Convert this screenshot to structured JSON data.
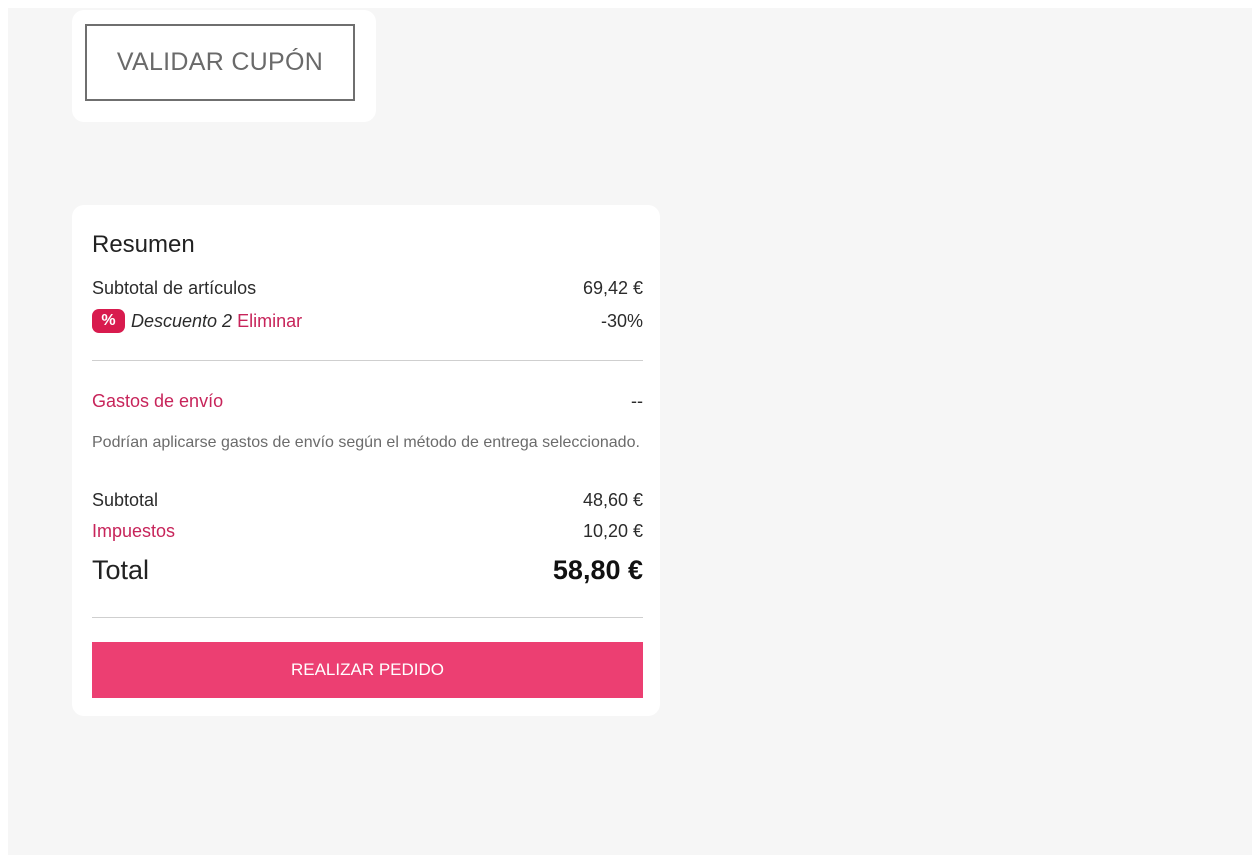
{
  "coupon": {
    "validate_label": "VALIDAR CUPÓN"
  },
  "summary": {
    "title": "Resumen",
    "items_subtotal_label": "Subtotal de artículos",
    "items_subtotal_value": "69,42 €",
    "discount": {
      "badge": "%",
      "name": "Descuento 2",
      "remove_label": "Eliminar",
      "value": "-30%"
    },
    "shipping_label": "Gastos de envío",
    "shipping_value": "--",
    "shipping_note": "Podrían aplicarse gastos de envío según el método de entrega seleccionado.",
    "subtotal_label": "Subtotal",
    "subtotal_value": "48,60 €",
    "taxes_label": "Impuestos",
    "taxes_value": "10,20 €",
    "total_label": "Total",
    "total_value": "58,80 €",
    "place_order_label": "REALIZAR PEDIDO"
  },
  "colors": {
    "accent": "#ec3f72",
    "link": "#c7245a",
    "badge": "#d81b4e",
    "background": "#f6f6f6"
  }
}
